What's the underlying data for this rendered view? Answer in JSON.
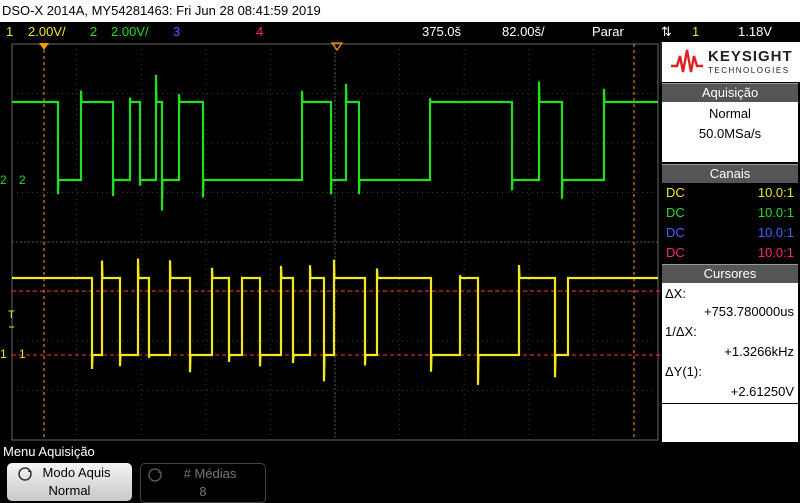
{
  "title_bar": {
    "text": "DSO-X 2014A, MY54281463: Fri Jun 28 08:41:59 2019"
  },
  "status_bar": {
    "ch1_num": "1",
    "ch1_scale": "2.00V/",
    "ch2_num": "2",
    "ch2_scale": "2.00V/",
    "ch3_num": "3",
    "ch4_num": "4",
    "timebase": "375.0š",
    "delay": "82.00š/",
    "run_state": "Parar",
    "trigger_edge_icon": "rising-falling-edge-icon",
    "trigger_source": "1",
    "trigger_level": "1.18V"
  },
  "colors": {
    "ch1": "#f2e81a",
    "ch2": "#22dd22",
    "ch3": "#4060ff",
    "ch4": "#ff2a6a",
    "marker": "#ff9900",
    "cursor": "#ff3333"
  },
  "plot": {
    "ch2_marker": "2",
    "ch1_marker": "1",
    "trigger_marker": "T"
  },
  "logo": {
    "brand": "KEYSIGHT",
    "sub": "TECHNOLOGIES"
  },
  "side_panel": {
    "acquisition": {
      "title": "Aquisição",
      "mode": "Normal",
      "rate": "50.0MSa/s"
    },
    "channels": {
      "title": "Canais",
      "rows": [
        {
          "coupling": "DC",
          "probe": "10.0:1"
        },
        {
          "coupling": "DC",
          "probe": "10.0:1"
        },
        {
          "coupling": "DC",
          "probe": "10.0:1"
        },
        {
          "coupling": "DC",
          "probe": "10.0:1"
        }
      ]
    },
    "cursors": {
      "title": "Cursores",
      "dx_label": "ΔX:",
      "dx_value": "+753.780000us",
      "inv_dx_label": "1/ΔX:",
      "inv_dx_value": "+1.3266kHz",
      "dy_label": "ΔY(1):",
      "dy_value": "+2.61250V"
    }
  },
  "menu": {
    "label": "Menu Aquisição",
    "softkeys": [
      {
        "title": "Modo Aquis",
        "value": "Normal"
      },
      {
        "title": "# Médias",
        "value": "8"
      }
    ]
  }
}
